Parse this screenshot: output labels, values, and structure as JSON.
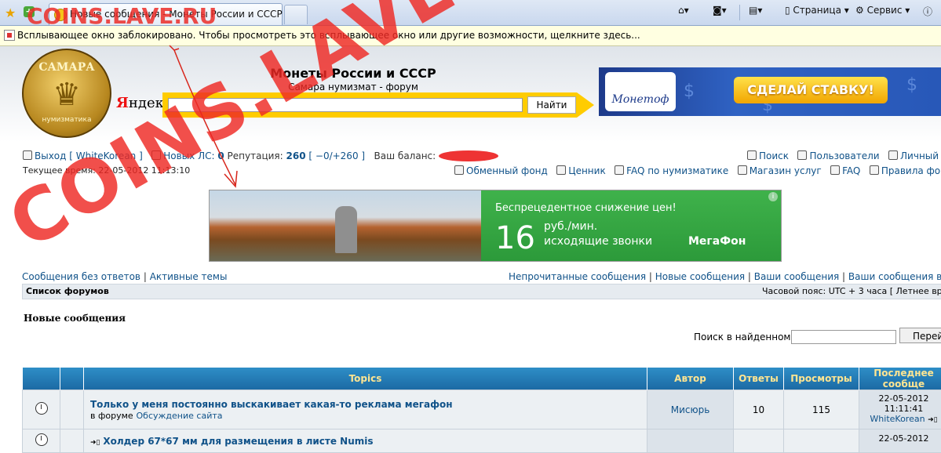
{
  "browser": {
    "tab_title": "Новые сообщения - Монеты России и СССР",
    "toolbar": {
      "page_label": "Страница",
      "service_label": "Сервис"
    }
  },
  "infobar": {
    "text": "Всплывающее окно заблокировано. Чтобы просмотреть это всплывающее окно или другие возможности, щелкните здесь..."
  },
  "header": {
    "site_title": "Монеты России и СССР",
    "site_desc": "Самара нумизмат - форум",
    "logo_top": "САМАРА",
    "logo_bottom": "нумизматика",
    "yandex": "Яндекс",
    "search_button": "Найти",
    "banner1": {
      "brand": "Монетоф",
      "cta": "СДЕЛАЙ СТАВКУ!"
    }
  },
  "userbar": {
    "logout": "Выход [ WhiteKorean ]",
    "new_pm_label": "Новых ЛС:",
    "new_pm_count": "0",
    "reputation_label": "Репутация:",
    "reputation_value": "260",
    "reputation_detail": "[ −0/+260 ]",
    "balance_label": "Ваш баланс:",
    "search": "Поиск",
    "users": "Пользователи",
    "personal": "Личный р",
    "exchange": "Обменный фонд",
    "price_list": "Ценник",
    "faq_numismatics": "FAQ по нумизматике",
    "services_shop": "Магазин услуг",
    "faq": "FAQ",
    "rules": "Правила фо",
    "current_time": "Текущее время: 22-05-2012 11:13:10"
  },
  "banner2": {
    "headline": "Беспрецедентное снижение цен!",
    "number": "16",
    "line1": "руб./мин.",
    "line2": "исходящие звонки",
    "brand": "МегаФон",
    "info": "i"
  },
  "nav": {
    "unanswered": "Сообщения без ответов",
    "active": "Активные темы",
    "sep": "|",
    "unread": "Непрочитанные сообщения",
    "new_posts": "Новые сообщения",
    "your_posts": "Ваши сообщения",
    "your_auctions": "Ваши сообщения в аукц",
    "breadcrumb": "Список форумов",
    "timezone": "Часовой пояс: UTC + 3 часа [ Летнее вр"
  },
  "main": {
    "heading": "Новые сообщения",
    "search_label": "Поиск в найденном:",
    "search_button": "Перей"
  },
  "table": {
    "headers": [
      "",
      "",
      "Topics",
      "Автор",
      "Ответы",
      "Просмотры",
      "Последнее сообще"
    ],
    "rows": [
      {
        "title": "Только у меня постоянно выскакивает какая-то реклама мегафон",
        "in_forum_label": "в форуме",
        "forum": "Обсуждение сайта",
        "author": "Мисюрь",
        "replies": "10",
        "views": "115",
        "last_date": "22-05-2012",
        "last_time": "11:11:41",
        "last_user": "WhiteKorean"
      },
      {
        "title": "Холдер 67*67 мм для размещения в листе Numis",
        "in_forum_label": "",
        "forum": "",
        "author": "",
        "replies": "",
        "views": "",
        "last_date": "22-05-2012",
        "last_time": "",
        "last_user": ""
      }
    ]
  },
  "watermark": "COINS.LAVE.RU",
  "watermark_small": "COINS.LAVE.RU",
  "colors": {
    "link": "#105289",
    "header_blue": "#1c6aa4",
    "header_text": "#ffe592",
    "watermark": "#ee2823",
    "megafon_green": "#2c9a3a"
  }
}
